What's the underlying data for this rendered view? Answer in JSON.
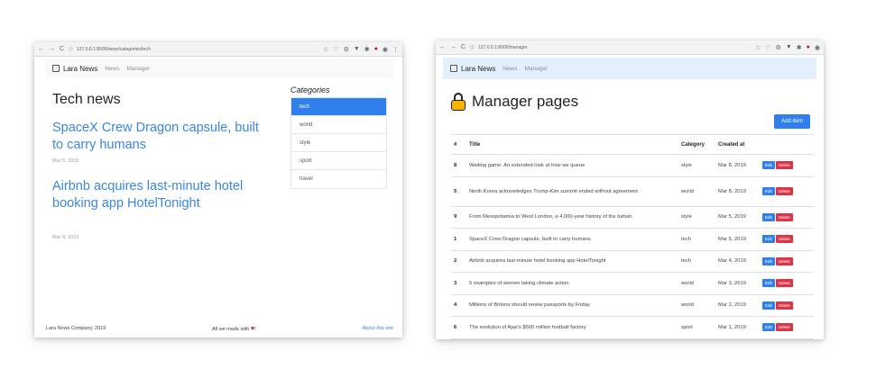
{
  "left": {
    "url": "127.0.0.1:8000/news/categories/tech",
    "brand": "Lara News",
    "nav": [
      "News",
      "Manager"
    ],
    "page_title": "Tech news",
    "articles": [
      {
        "title": "SpaceX Crew Dragon capsule, built to carry humans",
        "date": "Mar 5, 2019"
      },
      {
        "title": "Airbnb acquires last-minute hotel booking app HotelTonight",
        "date": "Mar 4, 2019"
      }
    ],
    "categories_title": "Categories",
    "categories": [
      "tech",
      "world",
      "style",
      "sport",
      "travel"
    ],
    "active_category": "tech",
    "footer": {
      "company": "Lara News Company, 2019",
      "made_prefix": "All we made with",
      "made_suffix": "!",
      "about": "About this site"
    }
  },
  "right": {
    "url": "127.0.0.1:8000/manager",
    "brand": "Lara News",
    "nav": [
      "News",
      "Manager"
    ],
    "page_title": "Manager pages",
    "add_button": "Add item",
    "columns": [
      "#",
      "Title",
      "Category",
      "Created at",
      ""
    ],
    "rows": [
      {
        "id": "8",
        "title": "Waiting game: An extended look at how we queue",
        "category": "style",
        "created": "Mar 8, 2019"
      },
      {
        "id": "5",
        "title": "North Korea acknowledges Trump-Kim summit ended without agreement",
        "category": "world",
        "created": "Mar 8, 2019"
      },
      {
        "id": "9",
        "title": "From Mesopotamia to West London, a 4,000-year history of the turban",
        "category": "style",
        "created": "Mar 5, 2019"
      },
      {
        "id": "1",
        "title": "SpaceX Crew Dragon capsule, built to carry humans",
        "category": "tech",
        "created": "Mar 5, 2019"
      },
      {
        "id": "2",
        "title": "Airbnb acquires last-minute hotel booking app HotelTonight",
        "category": "tech",
        "created": "Mar 4, 2019"
      },
      {
        "id": "3",
        "title": "5 examples of women taking climate action",
        "category": "world",
        "created": "Mar 3, 2019"
      },
      {
        "id": "4",
        "title": "Millions of Britons should renew passports by Friday",
        "category": "world",
        "created": "Mar 2, 2019"
      },
      {
        "id": "6",
        "title": "The evolution of Ajax's $500 million football factory",
        "category": "sport",
        "created": "Mar 1, 2019"
      }
    ],
    "edit_label": "Edit",
    "delete_label": "Delete"
  },
  "colors": {
    "primary": "#2f80ed",
    "danger": "#dc3545",
    "link": "#3b86e0",
    "lock": "#f5b400",
    "navbar_right": "#e3f0fb"
  },
  "icons": [
    "back-arrow-icon",
    "forward-arrow-icon",
    "reload-icon",
    "info-icon",
    "star-icon",
    "lock-icon",
    "heart-icon",
    "newspaper-icon"
  ]
}
